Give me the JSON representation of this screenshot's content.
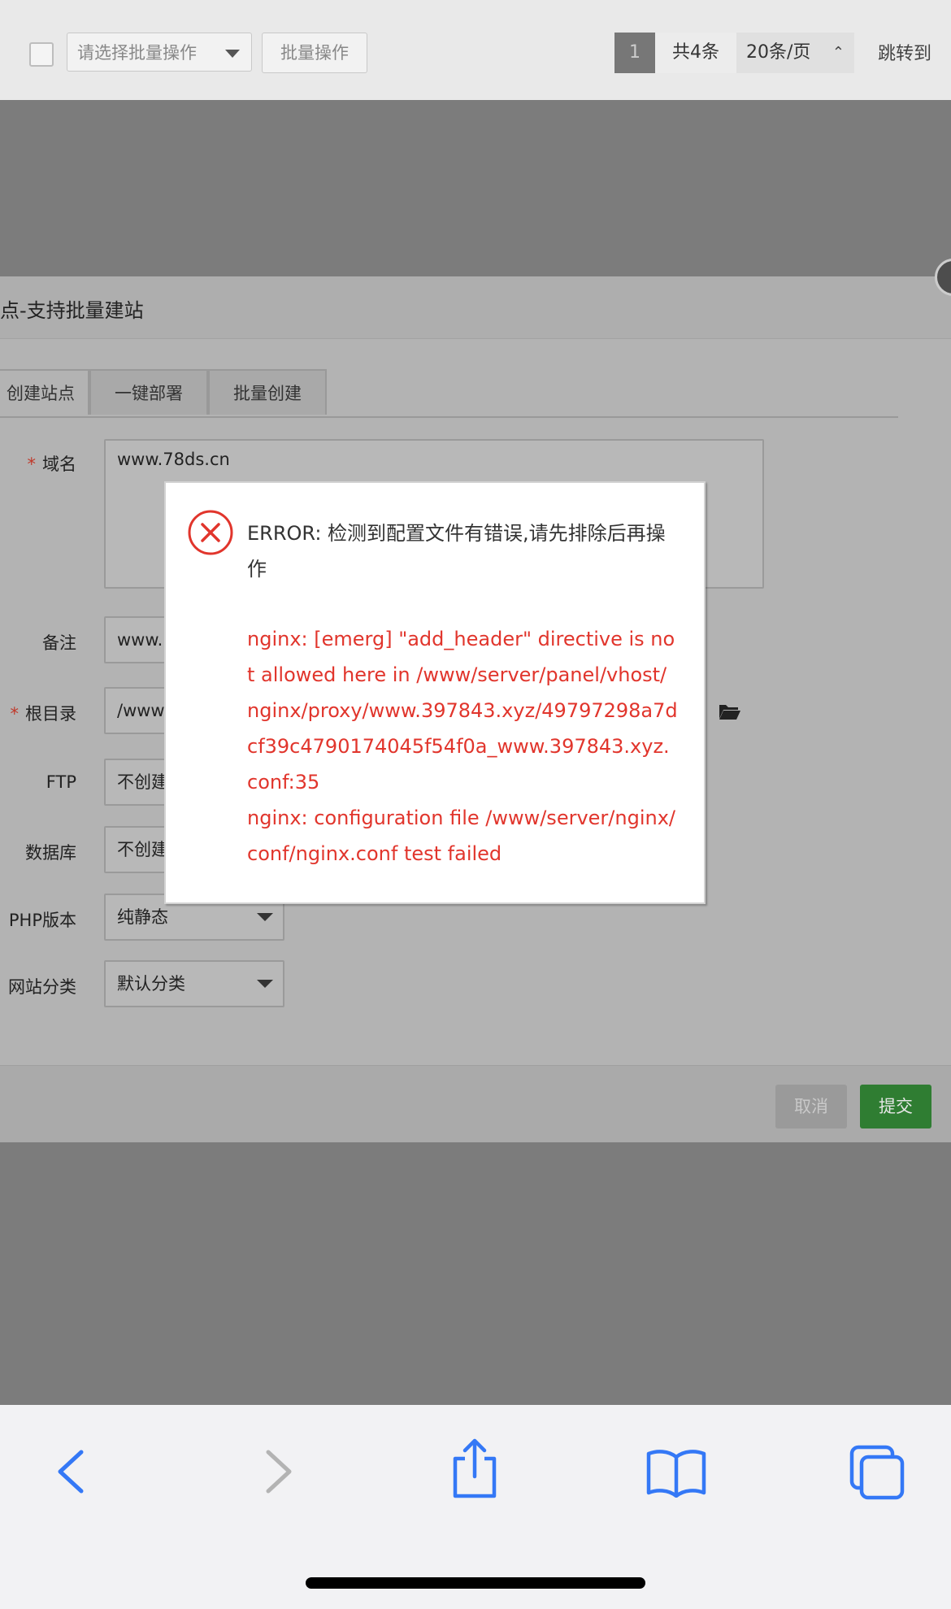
{
  "toolbar": {
    "batch_select_placeholder": "请选择批量操作",
    "batch_button": "批量操作",
    "page_current": "1",
    "total_label": "共4条",
    "per_page": "20条/页",
    "jump_label": "跳转到"
  },
  "dialog": {
    "title": "点-支持批量建站",
    "tabs": [
      "创建站点",
      "一键部署",
      "批量创建"
    ],
    "fields": {
      "domain": {
        "label": "域名",
        "value": "www.78ds.cn"
      },
      "note": {
        "label": "备注",
        "value": "www."
      },
      "root": {
        "label": "根目录",
        "value": "/www"
      },
      "ftp": {
        "label": "FTP",
        "value": "不创建"
      },
      "db": {
        "label": "数据库",
        "value": "不创建"
      },
      "php": {
        "label": "PHP版本",
        "value": "纯静态"
      },
      "category": {
        "label": "网站分类",
        "value": "默认分类"
      }
    },
    "cancel": "取消",
    "submit": "提交"
  },
  "error": {
    "message": "ERROR: 检测到配置文件有错误,请先排除后再操作",
    "detail_line1": "nginx: [emerg] \"add_header\" directive is not allowed here in /www/server/panel/vhost/nginx/proxy/www.397843.xyz/49797298a7dcf39c4790174045f54f0a_www.397843.xyz.conf:35",
    "detail_line2": "nginx: configuration file /www/server/nginx/conf/nginx.conf test failed"
  },
  "colors": {
    "error_red": "#e1352c",
    "submit_green": "#2f7d32",
    "ios_blue": "#3478f6"
  }
}
